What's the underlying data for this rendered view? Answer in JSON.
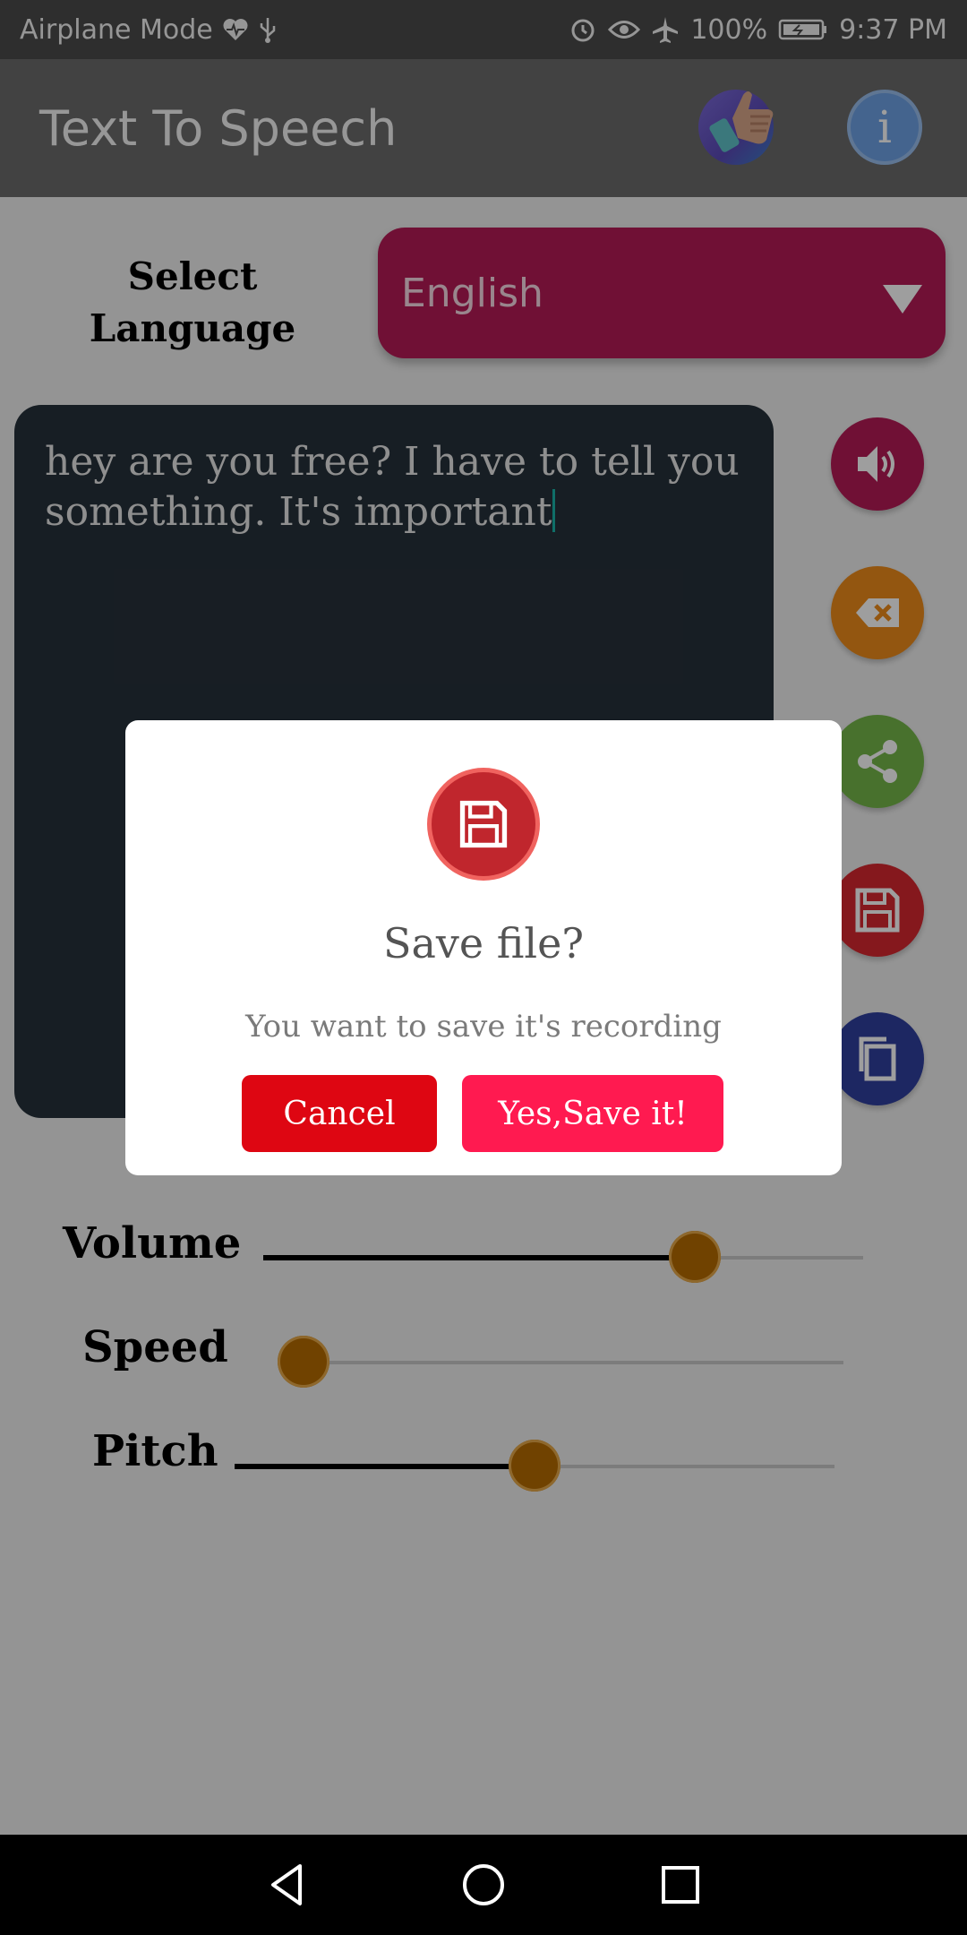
{
  "status_bar": {
    "mode_text": "Airplane Mode",
    "battery_text": "100%",
    "time": "9:37 PM",
    "icons": [
      "heart-monitor-icon",
      "usb-icon",
      "alarm-icon",
      "eye-icon",
      "airplane-icon",
      "battery-icon"
    ]
  },
  "app_bar": {
    "title": "Text To Speech",
    "rate_icon": "thumbs-up-icon",
    "info_label": "i"
  },
  "language": {
    "label": "Select Language",
    "selected": "English"
  },
  "editor": {
    "text": "hey are you free? I have to tell you something. It's important"
  },
  "side_actions": [
    "speaker-icon",
    "backspace-icon",
    "share-icon",
    "floppy-disk-icon",
    "copy-icon"
  ],
  "sliders": {
    "volume": {
      "label": "Volume",
      "value": 0.72
    },
    "speed": {
      "label": "Speed",
      "value": 0.04
    },
    "pitch": {
      "label": "Pitch",
      "value": 0.5
    }
  },
  "dialog": {
    "title": "Save file?",
    "message": "You want to save it's recording",
    "cancel_label": "Cancel",
    "confirm_label": "Yes,Save it!"
  },
  "colors": {
    "accent": "#b51a56",
    "slider_thumb": "#b56b00",
    "cancel": "#de0612",
    "confirm": "#ff1a50"
  }
}
